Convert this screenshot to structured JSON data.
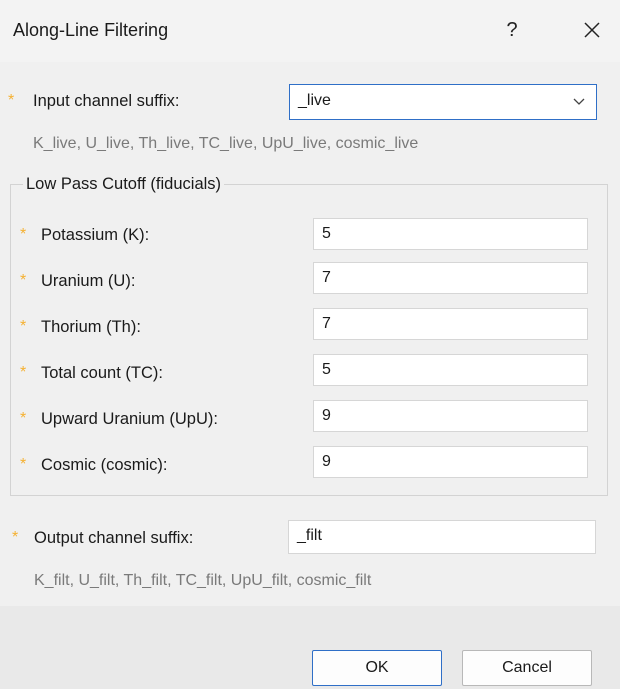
{
  "window": {
    "title": "Along-Line Filtering",
    "help_label": "?",
    "close_icon": "close-icon"
  },
  "colors": {
    "required_star": "#f5b132",
    "accent_border": "#2f6fc7",
    "hint_text": "#7a7a7a"
  },
  "input_channel": {
    "star": "*",
    "label": "Input channel suffix:",
    "value": "_live",
    "hint": "K_live, U_live, Th_live, TC_live, UpU_live, cosmic_live"
  },
  "lowpass": {
    "group_title": "Low Pass Cutoff (fiducials)",
    "rows": [
      {
        "star": "*",
        "label": "Potassium (K):",
        "value": "5"
      },
      {
        "star": "*",
        "label": "Uranium (U):",
        "value": "7"
      },
      {
        "star": "*",
        "label": "Thorium (Th):",
        "value": "7"
      },
      {
        "star": "*",
        "label": "Total count (TC):",
        "value": "5"
      },
      {
        "star": "*",
        "label": "Upward Uranium (UpU):",
        "value": "9"
      },
      {
        "star": "*",
        "label": "Cosmic (cosmic):",
        "value": "9"
      }
    ]
  },
  "output_channel": {
    "star": "*",
    "label": "Output channel suffix:",
    "value": "_filt",
    "hint": "K_filt, U_filt, Th_filt, TC_filt, UpU_filt, cosmic_filt"
  },
  "buttons": {
    "ok": "OK",
    "cancel": "Cancel"
  }
}
